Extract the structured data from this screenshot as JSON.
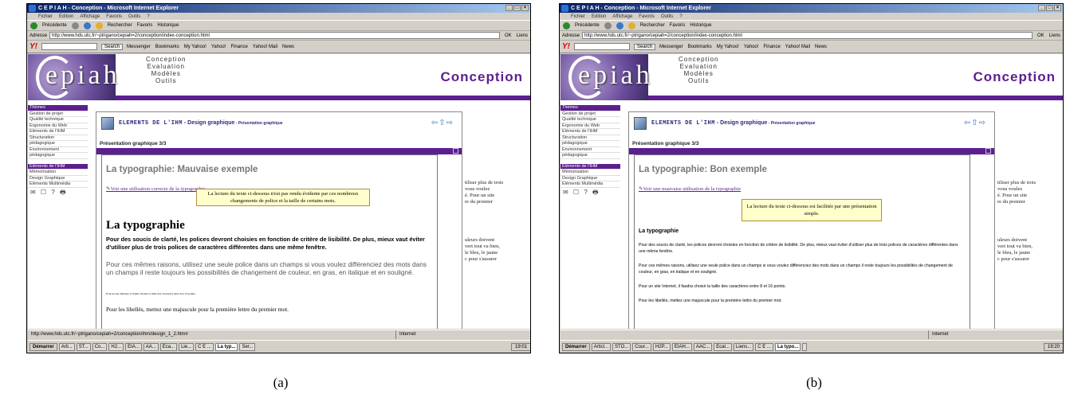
{
  "captions": [
    "(a)",
    "(b)"
  ],
  "shots": [
    {
      "window_title": "C E P I A H - Conception - Microsoft Internet Explorer",
      "menu": [
        "Fichier",
        "Edition",
        "Affichage",
        "Favoris",
        "Outils",
        "?"
      ],
      "toolbar": [
        "Précédente",
        "Rechercher",
        "Favoris",
        "Historique"
      ],
      "address_label": "Adresse",
      "address": "http://www.hds.utc.fr/~ptrigano/cepiah=2/conception/index-conception.html",
      "go_label": "OK",
      "links_label": "Liens",
      "yahoo_search_label": "Search",
      "yahoo_links": [
        "Messenger",
        "Bookmarks",
        "My Yahoo!",
        "Yahoo!",
        "Finance",
        "Yahoo! Mail",
        "News"
      ],
      "logo": "epiah",
      "menu_words": [
        "Conception",
        "Evaluation",
        "Modèles",
        "Outils"
      ],
      "page_heading": "Conception",
      "sidebar": [
        {
          "label": "Thèmes",
          "kind": "head"
        },
        {
          "label": "Gestion de projet",
          "kind": "item"
        },
        {
          "label": "Qualité technique",
          "kind": "item"
        },
        {
          "label": "Ergonomie du Web",
          "kind": "item"
        },
        {
          "label": "Eléments de l'IHM",
          "kind": "item"
        },
        {
          "label": "Structuration",
          "kind": "item"
        },
        {
          "label": "pédagogique",
          "kind": "item"
        },
        {
          "label": "Environnement",
          "kind": "item"
        },
        {
          "label": "pédagogique",
          "kind": "item"
        },
        {
          "label": "Eléments de l'IHM",
          "kind": "sel"
        },
        {
          "label": "Mémorisation",
          "kind": "item"
        },
        {
          "label": "Design Graphique",
          "kind": "item"
        },
        {
          "label": "Eléments Multimédia",
          "kind": "item"
        }
      ],
      "sidebar_icons": "✉ ☐ ? 🖶",
      "frame_title_mono": "ELEMENTS DE L'IHM",
      "frame_title_rest": " - Design graphique",
      "frame_title_small": " - Présentation graphique",
      "pres_label": "Présentation graphique 3/3",
      "panel_title": "La typographie: Mauvaise exemple",
      "panel_link": "Voir une utilisation correcte de la typographie",
      "tooltip": "La lecture du texte ci-dessous n'est pas rendu évidente par ces nombreux changements de police et la taille de certains mots.",
      "typo_heading": "La typographie",
      "para1": "Pour des soucis de clarté, les polices devront choisies en fonction de critère de lisibilité. De plus, mieux vaut éviter d'utiliser plus de trois polices de caractères différentes dans une même fenêtre.",
      "para2": "Pour ces mêmes raisons, utilisez une seule police dans un champs si vous voulez différenciez des mots dans un champs il reste toujours les possibilités de changement de couleur, en gras, en italique et en souligné.",
      "para3": "Pour un site Internet, il faudra choisir la taille des caractères entre 8 et 16 points.",
      "para4": "Pour les libellés, mettez une majuscule pour la première lettre du premier mot.",
      "right_peek_1": [
        "tiliser plus de trois",
        "vous voulez",
        "é. Pour un site",
        "re du premier"
      ],
      "right_peek_2": [
        "uleurs doivent",
        "vert tout va bien,",
        "le bleu, le jaune",
        "c pour s'assurer"
      ],
      "status": "http://www.hds.utc.fr/~ptrigano/cepiah=2/conception/ihm/design_1_2.htm#",
      "zone": "Internet",
      "start": "Démarrer",
      "tasks": [
        "Arti...",
        "ST...",
        "Co...",
        "H2...",
        "EIA...",
        "AA...",
        "Eca...",
        "Lie...",
        "C E ...",
        "La typ...",
        "Ser..."
      ],
      "clock": "19:01"
    },
    {
      "window_title": "C E P I A H - Conception - Microsoft Internet Explorer",
      "menu": [
        "Fichier",
        "Edition",
        "Affichage",
        "Favoris",
        "Outils",
        "?"
      ],
      "toolbar": [
        "Précédente",
        "Rechercher",
        "Favoris",
        "Historique"
      ],
      "address_label": "Adresse",
      "address": "http://www.hds.utc.fr/~ptrigano/cepiah=2/conception/index-conception.html",
      "go_label": "OK",
      "links_label": "Liens",
      "yahoo_search_label": "Search",
      "yahoo_links": [
        "Messenger",
        "Bookmarks",
        "My Yahoo!",
        "Yahoo!",
        "Finance",
        "Yahoo! Mail",
        "News"
      ],
      "logo": "epiah",
      "menu_words": [
        "Conception",
        "Evaluation",
        "Modèles",
        "Outils"
      ],
      "page_heading": "Conception",
      "sidebar": [
        {
          "label": "Thèmes",
          "kind": "head"
        },
        {
          "label": "Gestion de projet",
          "kind": "item"
        },
        {
          "label": "Qualité technique",
          "kind": "item"
        },
        {
          "label": "Ergonomie du Web",
          "kind": "item"
        },
        {
          "label": "Eléments de l'IHM",
          "kind": "item"
        },
        {
          "label": "Structuration",
          "kind": "item"
        },
        {
          "label": "pédagogique",
          "kind": "item"
        },
        {
          "label": "Environnement",
          "kind": "item"
        },
        {
          "label": "pédagogique",
          "kind": "item"
        },
        {
          "label": "Eléments de l'IHM",
          "kind": "sel"
        },
        {
          "label": "Mémorisation",
          "kind": "item"
        },
        {
          "label": "Design Graphique",
          "kind": "item"
        },
        {
          "label": "Eléments Multimédia",
          "kind": "item"
        }
      ],
      "sidebar_icons": "✉ ☐ ? 🖶",
      "frame_title_mono": "ELEMENTS DE L'IHM",
      "frame_title_rest": " - Design graphique",
      "frame_title_small": " - Présentation graphique",
      "pres_label": "Présentation graphique 3/3",
      "panel_title": "La typographie: Bon exemple",
      "panel_link": "Voir une mauvaise utilisation de la typographie",
      "tooltip": "La lecture du texte ci-dessous est facilitée par une présentation simple.",
      "typo_heading": "La typographie",
      "para1": "Pour des soucis de clarté, les polices devront choisies en fonction de critère de lisibilité. De plus, mieux vaut éviter d'utiliser plus de trois polices de caractères différentes dans une même fenêtre.",
      "para2": "Pour ces mêmes raisons, utilisez une seule police dans un champs si vous voulez différenciez des mots dans un champs il reste toujours les possibilités de changement de couleur, en gras, en italique et en souligné.",
      "para3": "Pour un site Internet, il faudra choisir la taille des caractères entre 8 et 16 points.",
      "para4": "Pour les libellés, mettez une majuscule pour la première lettre du premier mot.",
      "right_peek_1": [
        "tiliser plus de trois",
        "vous voulez",
        "é. Pour un site",
        "re du premier"
      ],
      "right_peek_2": [
        "uleurs doivent",
        "vert tout va bien,",
        "le bleu, le jaune",
        "c pour s'assurer"
      ],
      "status": "",
      "zone": "Internet",
      "start": "Démarrer",
      "tasks": [
        "Articl...",
        "STO...",
        "Cour...",
        "H2P...",
        "EIAH...",
        "AAC...",
        "Ecal...",
        "Liens...",
        "C E ...",
        "La typo...",
        ""
      ],
      "clock": "19:20"
    }
  ]
}
